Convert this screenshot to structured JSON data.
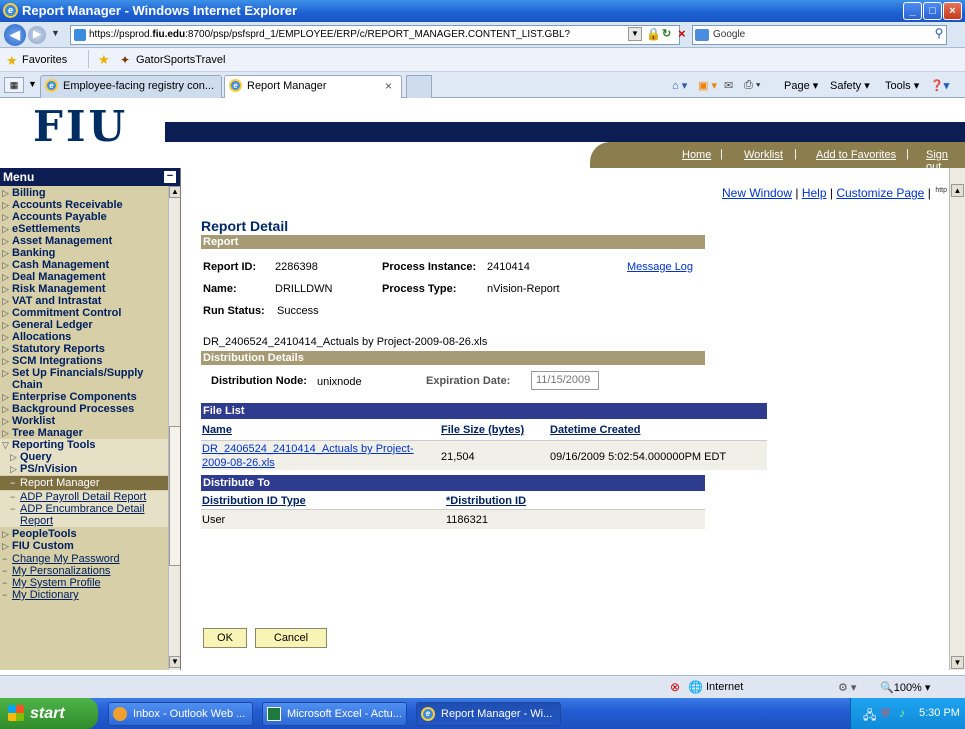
{
  "window": {
    "title": "Report Manager - Windows Internet Explorer"
  },
  "browser": {
    "url_prefix": "https://psprod.",
    "url_domain": "fiu.edu",
    "url_rest": ":8700/psp/psfsprd_1/EMPLOYEE/ERP/c/REPORT_MANAGER.CONTENT_LIST.GBL?",
    "search_placeholder": "Google",
    "favorites_label": "Favorites",
    "favorite_link": "GatorSportsTravel",
    "tabs": [
      {
        "label": "Employee-facing registry con..."
      },
      {
        "label": "Report Manager"
      }
    ],
    "toolbar": {
      "page": "Page",
      "safety": "Safety",
      "tools": "Tools"
    }
  },
  "header": {
    "logo_text": "FIU",
    "nav": {
      "home": "Home",
      "worklist": "Worklist",
      "add_favorites": "Add to Favorites",
      "sign_out": "Sign out"
    }
  },
  "menu": {
    "title": "Menu",
    "items": [
      "Billing",
      "Accounts Receivable",
      "Accounts Payable",
      "eSettlements",
      "Asset Management",
      "Banking",
      "Cash Management",
      "Deal Management",
      "Risk Management",
      "VAT and Intrastat",
      "Commitment Control",
      "General Ledger",
      "Allocations",
      "Statutory Reports",
      "SCM Integrations",
      "Set Up Financials/Supply",
      "Chain",
      "Enterprise Components",
      "Background Processes",
      "Worklist",
      "Tree Manager",
      "Reporting Tools",
      "Query",
      "PS/nVision",
      "Report Manager",
      "ADP Payroll Detail Report",
      "ADP Encumbrance Detail",
      "Report",
      "PeopleTools",
      "FIU Custom",
      "Change My Password",
      "My Personalizations",
      "My System Profile",
      "My Dictionary"
    ]
  },
  "content": {
    "links": {
      "new_window": "New Window",
      "help": "Help",
      "customize_page": "Customize Page",
      "http_icon_label": "http"
    },
    "title": "Report Detail",
    "report_section": "Report",
    "report_id_label": "Report ID:",
    "report_id": "2286398",
    "process_instance_label": "Process Instance:",
    "process_instance": "2410414",
    "message_log": "Message Log",
    "name_label": "Name:",
    "name": "DRILLDWN",
    "process_type_label": "Process Type:",
    "process_type": "nVision-Report",
    "run_status_label": "Run Status:",
    "run_status": "Success",
    "file_title": "DR_2406524_2410414_Actuals by Project-2009-08-26.xls",
    "distribution_section": "Distribution Details",
    "dist_node_label": "Distribution Node:",
    "dist_node": "unixnode",
    "expiration_label": "Expiration Date:",
    "expiration": "11/15/2009",
    "file_list": {
      "header": "File List",
      "columns": [
        "Name",
        "File Size (bytes)",
        "Datetime Created"
      ],
      "rows": [
        {
          "name_line1": "DR_2406524_2410414_Actuals by Project-",
          "name_line2": "2009-08-26.xls",
          "size": "21,504",
          "created": "09/16/2009  5:02:54.000000PM EDT"
        }
      ]
    },
    "distribute_to": {
      "header": "Distribute To",
      "columns": [
        "Distribution ID Type",
        "*Distribution ID"
      ],
      "rows": [
        {
          "type": "User",
          "id": "1186321"
        }
      ]
    },
    "buttons": {
      "ok": "OK",
      "cancel": "Cancel"
    }
  },
  "statusbar": {
    "zone": "Internet",
    "zoom": "100%"
  },
  "taskbar": {
    "start": "start",
    "items": [
      "Inbox - Outlook Web ...",
      "Microsoft Excel - Actu...",
      "Report Manager - Wi..."
    ],
    "clock": "5:30 PM"
  }
}
